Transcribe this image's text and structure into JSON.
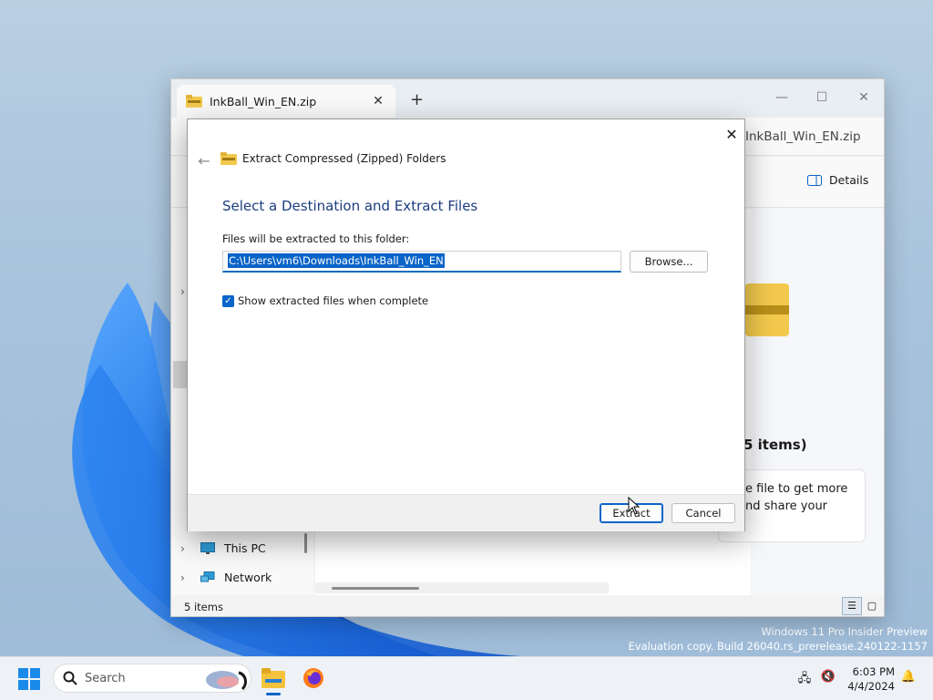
{
  "desktop": {
    "watermark_line1": "Windows 11 Pro Insider Preview",
    "watermark_line2": "Evaluation copy. Build 26040.rs_prerelease.240122-1157"
  },
  "explorer": {
    "tab_title": "InkBall_Win_EN.zip",
    "address_text": "InkBall_Win_EN.zip",
    "details_label": "Details",
    "nav": [
      {
        "label": "This PC"
      },
      {
        "label": "Network"
      }
    ],
    "pane_title": "5 items)",
    "pane_text_line1": "e file to get more",
    "pane_text_line2": "nd share your",
    "status": "5 items"
  },
  "dialog": {
    "header": "Extract Compressed (Zipped) Folders",
    "heading": "Select a Destination and Extract Files",
    "folder_label": "Files will be extracted to this folder:",
    "path_value": "C:\\Users\\vm6\\Downloads\\InkBall_Win_EN",
    "browse_label": "Browse...",
    "checkbox_label": "Show extracted files when complete",
    "checkbox_checked": true,
    "extract_label": "Extract",
    "cancel_label": "Cancel"
  },
  "taskbar": {
    "search_placeholder": "Search",
    "time": "6:03 PM",
    "date": "4/4/2024"
  },
  "colors": {
    "accent": "#0a64c8",
    "heading": "#1c3d80"
  }
}
